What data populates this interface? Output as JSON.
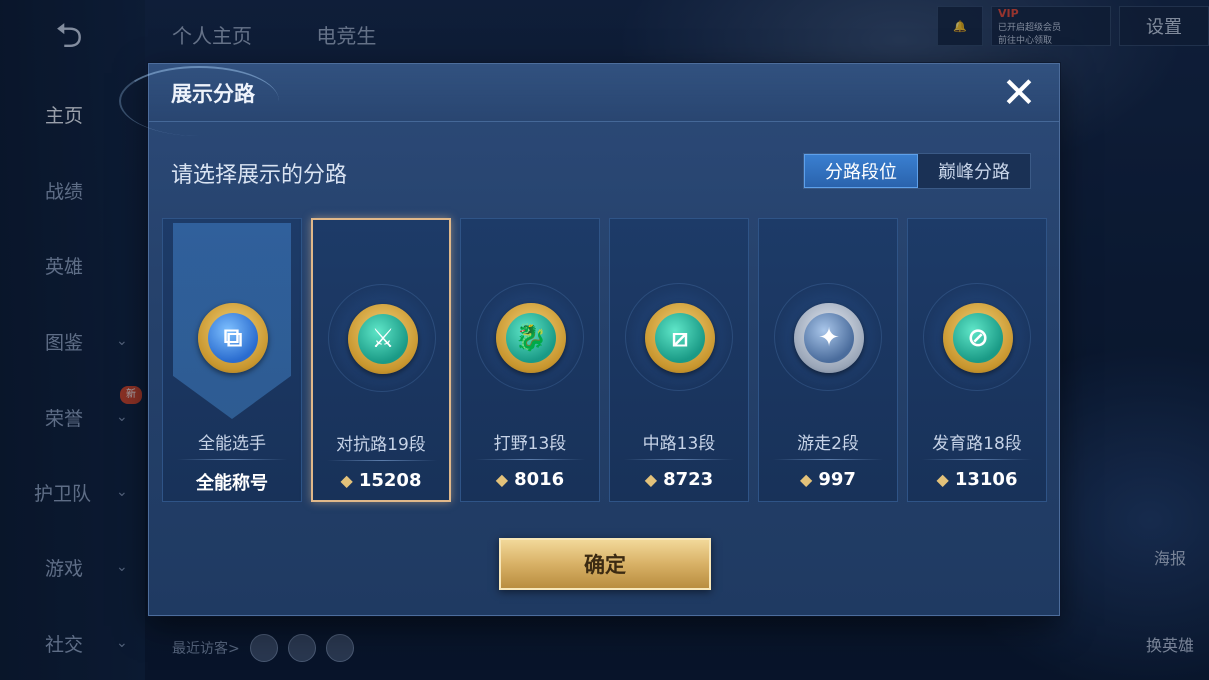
{
  "background": {
    "sidebar": {
      "back_icon": "back-arrow-icon",
      "items": [
        {
          "label": "主页",
          "active": true,
          "chevron": false
        },
        {
          "label": "战绩",
          "active": false,
          "chevron": false
        },
        {
          "label": "英雄",
          "active": false,
          "chevron": false
        },
        {
          "label": "图鉴",
          "active": false,
          "chevron": true
        },
        {
          "label": "荣誉",
          "active": false,
          "chevron": true
        },
        {
          "label": "护卫队",
          "active": false,
          "chevron": true
        },
        {
          "label": "游戏",
          "active": false,
          "chevron": true
        },
        {
          "label": "社交",
          "active": false,
          "chevron": true
        }
      ],
      "new_badge": "新"
    },
    "top_tabs": [
      "个人主页",
      "电竞生"
    ],
    "top_right": {
      "vip_label": "VIP",
      "vip_text_1": "已开启超级会员",
      "vip_text_2": "前往中心领取",
      "settings_label": "设置"
    },
    "bottom": {
      "recent_visitors": "最近访客>"
    },
    "right_float": {
      "item1": "海报",
      "item2": "换英雄"
    }
  },
  "dialog": {
    "title": "展示分路",
    "close_icon": "close-icon",
    "subtitle": "请选择展示的分路",
    "toggle": {
      "options": [
        "分路段位",
        "巅峰分路"
      ],
      "selected": 0
    },
    "cards": [
      {
        "name": "全能选手",
        "score": "全能称号",
        "emblem": "blue",
        "selected": false,
        "banner": true,
        "has_mark": false
      },
      {
        "name": "对抗路19段",
        "score": "15208",
        "emblem": "teal",
        "selected": true,
        "banner": false,
        "has_mark": true
      },
      {
        "name": "打野13段",
        "score": "8016",
        "emblem": "teal",
        "selected": false,
        "banner": false,
        "has_mark": true
      },
      {
        "name": "中路13段",
        "score": "8723",
        "emblem": "teal",
        "selected": false,
        "banner": false,
        "has_mark": true
      },
      {
        "name": "游走2段",
        "score": "997",
        "emblem": "silver",
        "selected": false,
        "banner": false,
        "has_mark": true
      },
      {
        "name": "发育路18段",
        "score": "13106",
        "emblem": "teal",
        "selected": false,
        "banner": false,
        "has_mark": true
      }
    ],
    "confirm_label": "确定"
  },
  "colors": {
    "accent_blue": "#2a63ad",
    "gold": "#d8b166",
    "selected_border": "#e0b88a"
  }
}
